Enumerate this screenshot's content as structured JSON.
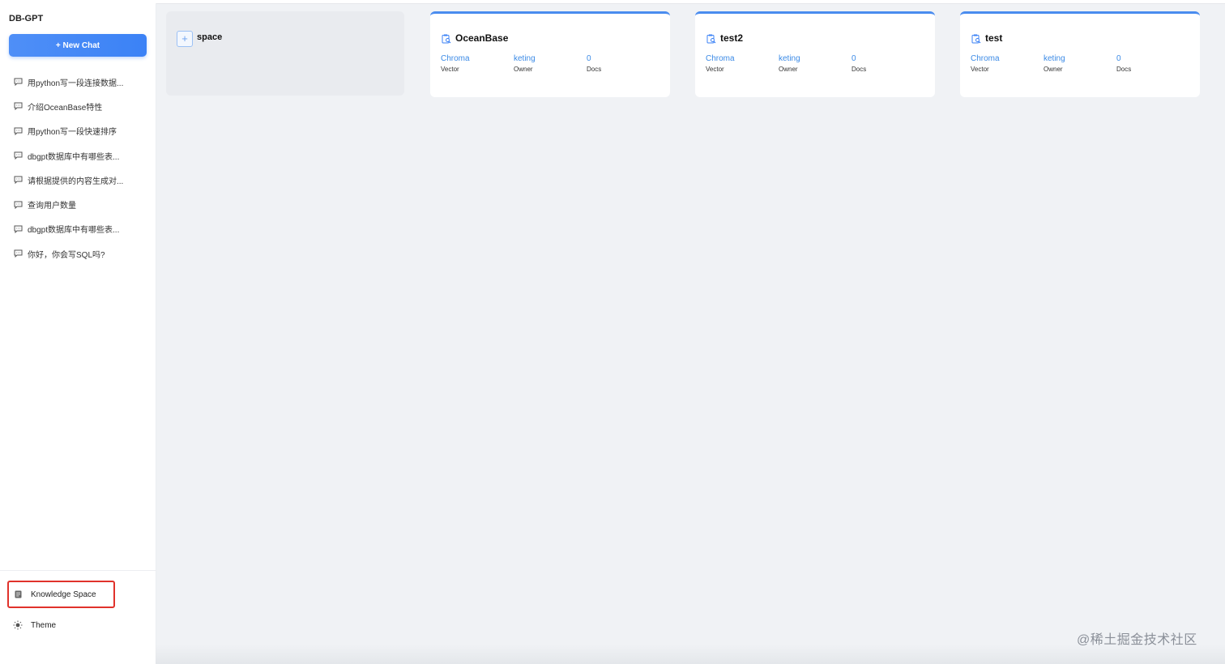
{
  "app": {
    "name": "DB-GPT"
  },
  "sidebar": {
    "new_chat_label": "+ New Chat",
    "history": [
      "用python写一段连接数据...",
      "介绍OceanBase特性",
      "用python写一段快速排序",
      "dbgpt数据库中有哪些表...",
      "请根据提供的内容生成对...",
      "查询用户数量",
      "dbgpt数据库中有哪些表...",
      "你好，你会写SQL吗?"
    ],
    "knowledge_space_label": "Knowledge Space",
    "theme_label": "Theme"
  },
  "main": {
    "add_space_label": "space",
    "cards": [
      {
        "name": "OceanBase",
        "vector": "Chroma",
        "vector_label": "Vector",
        "owner": "keting",
        "owner_label": "Owner",
        "docs": "0",
        "docs_label": "Docs"
      },
      {
        "name": "test2",
        "vector": "Chroma",
        "vector_label": "Vector",
        "owner": "keting",
        "owner_label": "Owner",
        "docs": "0",
        "docs_label": "Docs"
      },
      {
        "name": "test",
        "vector": "Chroma",
        "vector_label": "Vector",
        "owner": "keting",
        "owner_label": "Owner",
        "docs": "0",
        "docs_label": "Docs"
      }
    ]
  },
  "watermark": "@稀土掘金技术社区",
  "colors": {
    "accent": "#3b82f6",
    "highlight_border": "#e0322b",
    "background": "#f0f2f5"
  }
}
